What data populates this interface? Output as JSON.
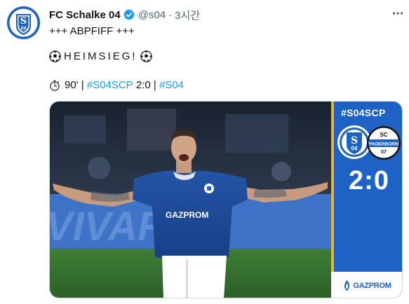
{
  "account": {
    "display_name": "FC Schalke 04",
    "handle": "@s04",
    "separator": "·",
    "time": "3시간"
  },
  "tweet": {
    "line1": "+++ ABPFIFF +++",
    "line2": "HEIMSIEG!",
    "line3": {
      "minute": "90'",
      "sep1": "|",
      "hashtag_match": "#S04SCP",
      "score": "2:0",
      "sep2": "|",
      "hashtag_club": "#S04"
    }
  },
  "media": {
    "panel_hashtag": "#S04SCP",
    "score": "2:0",
    "home_crest_text": "04",
    "away_crest_text": {
      "top": "SC",
      "middle": "PADERBORN",
      "bottom": "07"
    },
    "sponsor": "GAZPROM",
    "jersey_sponsor": "GAZPROM"
  },
  "colors": {
    "schalke_blue": "#1f62c6",
    "link_blue": "#1d9bf0",
    "gold": "#e4b340",
    "muted_text": "#536471"
  },
  "icons": [
    "schalke-avatar",
    "verified-badge",
    "more-options",
    "soccer-ball",
    "stopwatch",
    "gazprom-flame"
  ]
}
